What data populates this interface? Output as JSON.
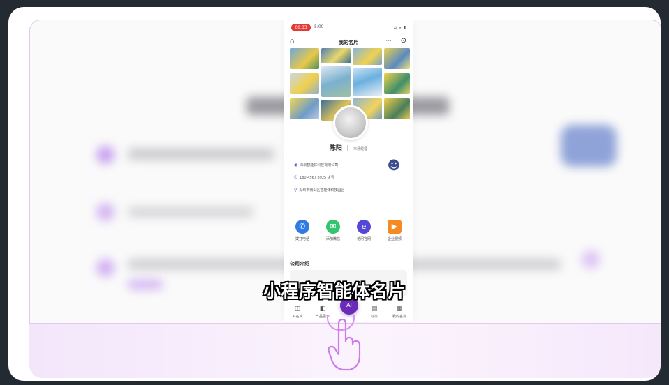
{
  "phone": {
    "status": {
      "rec_time": "00:33",
      "clock": "5:00",
      "icons": "⊿ ᯤ ▮"
    },
    "nav_title": "我的名片",
    "more_icon": "···",
    "name": "陈阳",
    "name_sub": "市场经理",
    "info_lines": [
      "深圳智能体科技有限公司",
      "180 4567 8925  拨号",
      "深圳市南山区智能体科技园区"
    ],
    "actions": [
      {
        "label": "拨打电话",
        "icon": "phone-icon",
        "color": "#2f7ae5",
        "glyph": "✆"
      },
      {
        "label": "添加微信",
        "icon": "wechat-icon",
        "color": "#33c46f",
        "glyph": "✉"
      },
      {
        "label": "访问官网",
        "icon": "browser-icon",
        "color": "#5447d6",
        "glyph": "e"
      },
      {
        "label": "企业视频",
        "icon": "video-icon",
        "color": "#f58a23",
        "glyph": "▶"
      }
    ],
    "section_title": "公司介绍",
    "tabs": [
      {
        "label": "AI名片",
        "glyph": "◫"
      },
      {
        "label": "产品展示",
        "glyph": "◧"
      },
      {
        "label": "AI",
        "glyph": "AI"
      },
      {
        "label": "动态",
        "glyph": "▤"
      },
      {
        "label": "我的名片",
        "glyph": "▦"
      }
    ]
  },
  "caption": "小程序智能体名片",
  "colors": {
    "accent": "#6a2bb8",
    "frame_border": "#e7c6f2",
    "background": "#242a31"
  }
}
